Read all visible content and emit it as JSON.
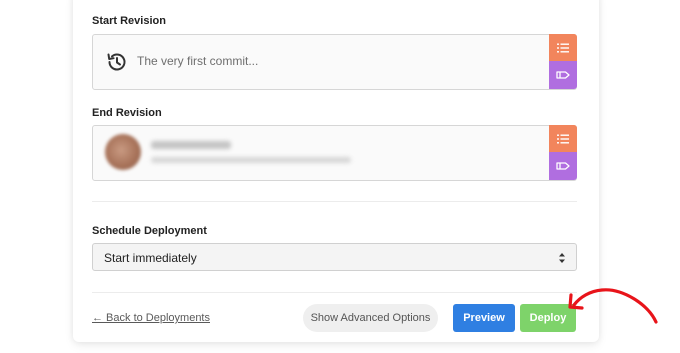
{
  "start_revision": {
    "label": "Start Revision",
    "placeholder": "The very first commit...",
    "icons": [
      "history-icon",
      "list-icon",
      "tag-icon"
    ]
  },
  "end_revision": {
    "label": "End Revision",
    "icons": [
      "avatar",
      "list-icon",
      "tag-icon"
    ]
  },
  "schedule": {
    "label": "Schedule Deployment",
    "selected": "Start immediately"
  },
  "footer": {
    "back_link": "← Back to Deployments",
    "advanced_button": "Show Advanced Options",
    "preview_button": "Preview",
    "deploy_button": "Deploy"
  },
  "colors": {
    "list_button": "#f2855c",
    "tag_button": "#b06ee0",
    "preview": "#2f7fe2",
    "deploy": "#7ed36a",
    "annotation_arrow": "#e8141a"
  }
}
